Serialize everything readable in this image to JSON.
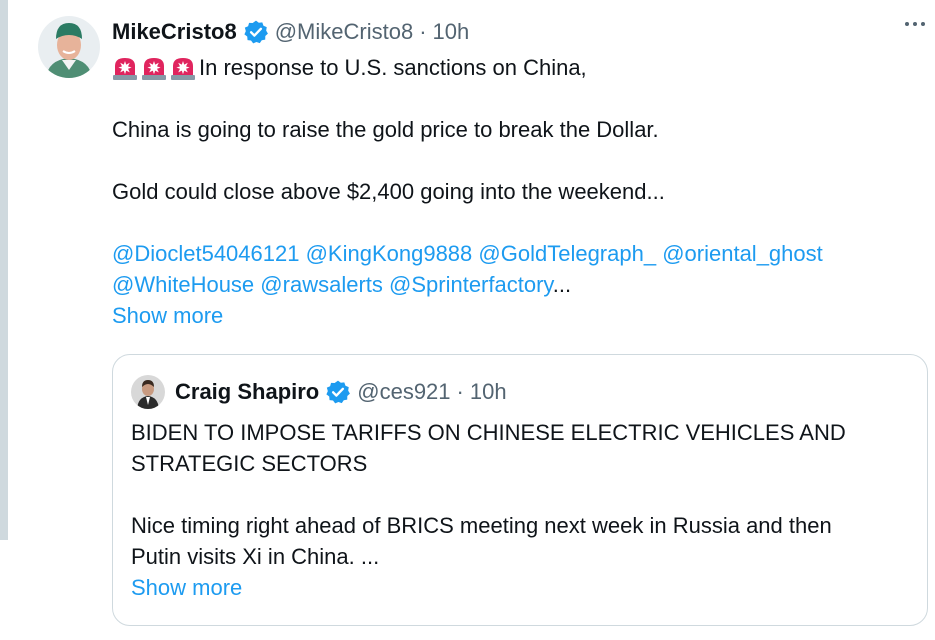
{
  "tweet": {
    "display_name": "MikeCristo8",
    "handle": "@MikeCristo8",
    "separator": "·",
    "time": "10h",
    "lines": {
      "first": "In response to U.S. sanctions on China,",
      "second": "China is going to raise the gold price to break the Dollar.",
      "third": "Gold could close above $2,400 going into the weekend..."
    },
    "emoji": "rotating-light-emoji",
    "mentions": [
      "@Dioclet54046121",
      "@KingKong9888",
      "@GoldTelegraph_",
      "@oriental_ghost",
      "@WhiteHouse",
      "@rawsalerts",
      "@Sprinterfactory"
    ],
    "ellipsis": "...",
    "show_more": "Show more"
  },
  "quote": {
    "display_name": "Craig Shapiro",
    "handle": "@ces921",
    "separator": "·",
    "time": "10h",
    "line1": "BIDEN TO IMPOSE TARIFFS ON CHINESE ELECTRIC VEHICLES AND",
    "line2": "STRATEGIC SECTORS",
    "line3": "Nice timing right ahead of BRICS meeting next week in Russia and then",
    "line4": "Putin visits Xi in China. ...",
    "show_more": "Show more"
  },
  "colors": {
    "link": "#1d9bf0",
    "secondary_text": "#536471",
    "verified": "#1d9bf0",
    "border": "#cfd9de"
  },
  "icons": {
    "verified": "verified-badge-icon",
    "more": "more-horizontal-icon"
  }
}
